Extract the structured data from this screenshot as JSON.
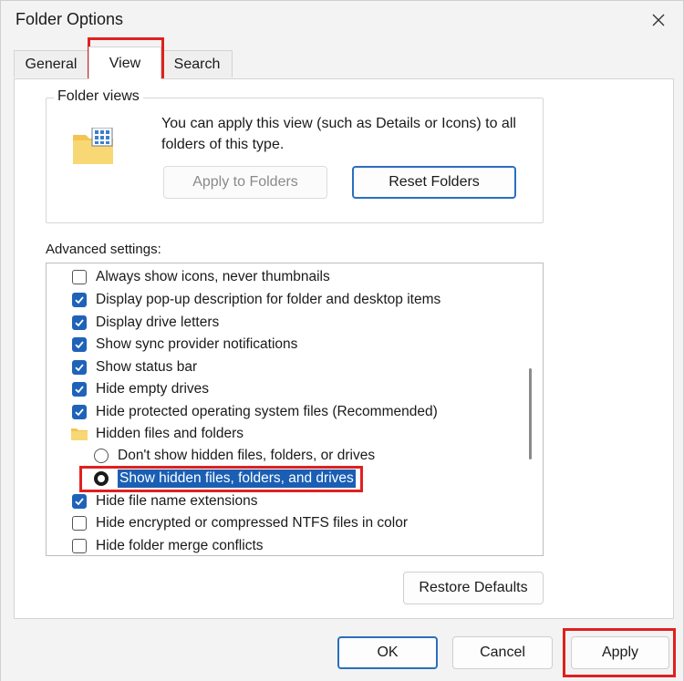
{
  "window": {
    "title": "Folder Options"
  },
  "tabs": [
    {
      "label": "General"
    },
    {
      "label": "View"
    },
    {
      "label": "Search"
    }
  ],
  "folder_views": {
    "legend": "Folder views",
    "description": "You can apply this view (such as Details or Icons) to all folders of this type.",
    "apply_to_folders": "Apply to Folders",
    "reset_folders": "Reset Folders"
  },
  "advanced": {
    "label": "Advanced settings:",
    "items": [
      {
        "type": "checkbox",
        "checked": false,
        "label": "Always show icons, never thumbnails"
      },
      {
        "type": "checkbox",
        "checked": true,
        "label": "Display pop-up description for folder and desktop items"
      },
      {
        "type": "checkbox",
        "checked": true,
        "label": "Display drive letters"
      },
      {
        "type": "checkbox",
        "checked": true,
        "label": "Show sync provider notifications"
      },
      {
        "type": "checkbox",
        "checked": true,
        "label": "Show status bar"
      },
      {
        "type": "checkbox",
        "checked": true,
        "label": "Hide empty drives"
      },
      {
        "type": "checkbox",
        "checked": true,
        "label": "Hide protected operating system files (Recommended)"
      },
      {
        "type": "folder",
        "label": "Hidden files and folders"
      },
      {
        "type": "radio",
        "selected": false,
        "label": "Don't show hidden files, folders, or drives"
      },
      {
        "type": "radio",
        "selected": true,
        "label": "Show hidden files, folders, and drives"
      },
      {
        "type": "checkbox",
        "checked": true,
        "label": "Hide file name extensions"
      },
      {
        "type": "checkbox",
        "checked": false,
        "label": "Hide encrypted or compressed NTFS files in color"
      },
      {
        "type": "checkbox",
        "checked": false,
        "label": "Hide folder merge conflicts"
      }
    ]
  },
  "buttons": {
    "restore_defaults": "Restore Defaults",
    "ok": "OK",
    "cancel": "Cancel",
    "apply": "Apply"
  },
  "colors": {
    "accent": "#1f63b8",
    "selection": "#1a5fb4",
    "highlight": "#e02020"
  }
}
